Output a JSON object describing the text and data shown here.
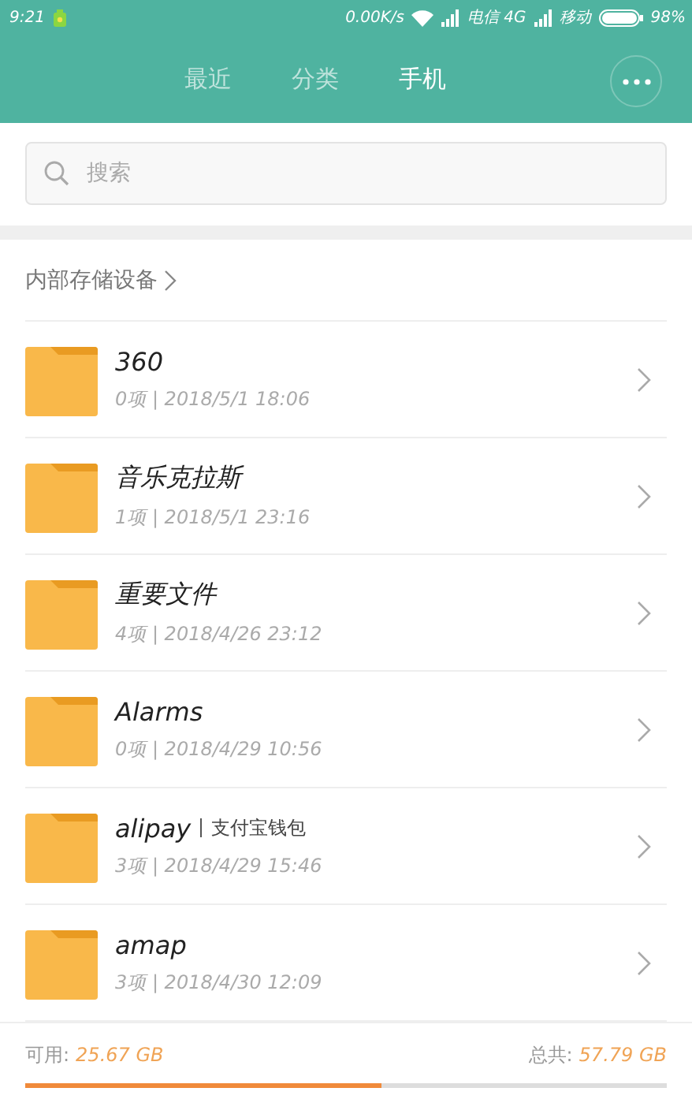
{
  "status_bar": {
    "time": "9:21",
    "speed": "0.00K/s",
    "carrier_1": "电信 4G",
    "carrier_2": "移动",
    "battery": "98%"
  },
  "tabs": [
    {
      "label": "最近",
      "selected": false
    },
    {
      "label": "分类",
      "selected": false
    },
    {
      "label": "手机",
      "selected": true
    }
  ],
  "search": {
    "placeholder": "搜索"
  },
  "breadcrumb": "内部存储设备",
  "folders": [
    {
      "name": "360",
      "meta": "0项 | 2018/5/1 18:06"
    },
    {
      "name": "音乐克拉斯",
      "meta": "1项 | 2018/5/1 23:16"
    },
    {
      "name": "重要文件",
      "meta": "4项 | 2018/4/26 23:12"
    },
    {
      "name": "Alarms",
      "meta": "0项 | 2018/4/29 10:56"
    },
    {
      "name": "alipay",
      "note": "支付宝钱包",
      "meta": "3项 | 2018/4/29 15:46"
    },
    {
      "name": "amap",
      "meta": "3项 | 2018/4/30 12:09"
    }
  ],
  "storage": {
    "available_label": "可用:",
    "available": "25.67 GB",
    "total_label": "总共:",
    "total": "57.79 GB",
    "level": 0.556
  }
}
